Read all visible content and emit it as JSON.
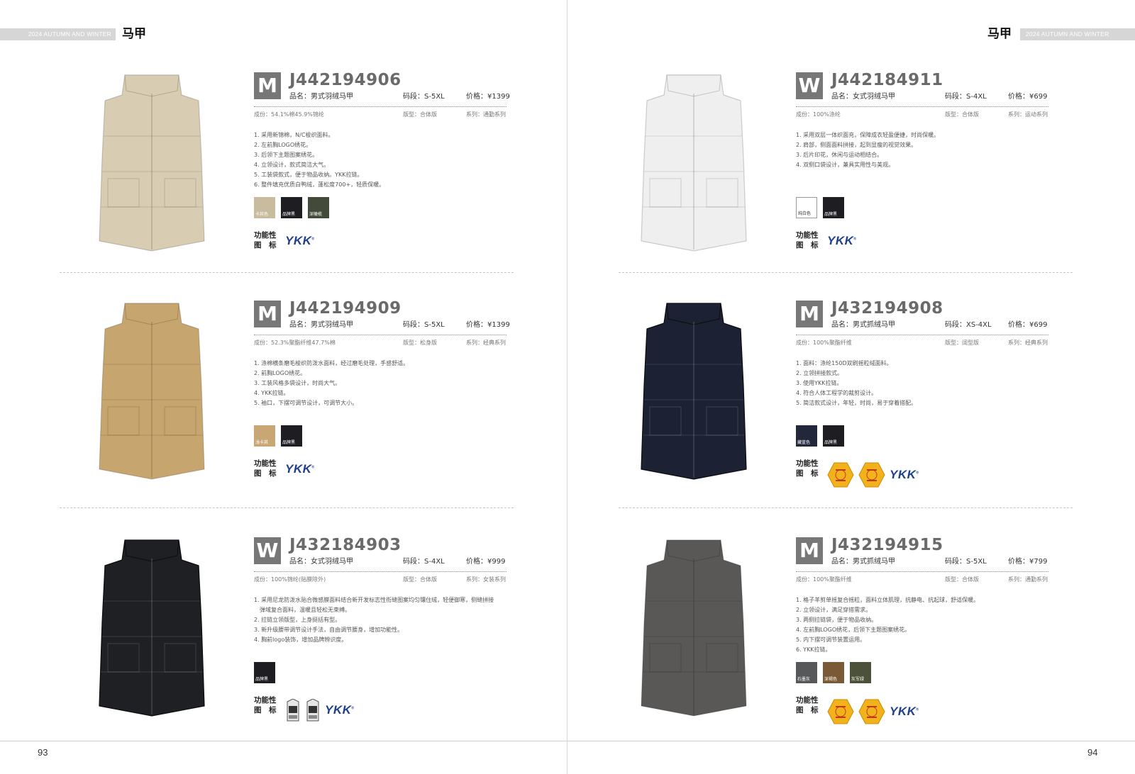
{
  "header": {
    "season": "2024 AUTUMN AND WINTER",
    "category": "马甲"
  },
  "footer": {
    "left_page": "93",
    "right_page": "94"
  },
  "labels": {
    "func_line1": "功能性",
    "func_line2": "图　标",
    "ykk": "YKK"
  },
  "colors": {
    "badge": "#777777",
    "code_text": "#6a6a6a",
    "ykk_blue": "#1e3e8e",
    "header_bar": "#d6d6d6"
  },
  "left": [
    {
      "gender": "M",
      "code": "J442194906",
      "name": "品名：男式羽绒马甲",
      "size": "码段：S-5XL",
      "price": "价格：¥1399",
      "material": "成份：54.1%棉45.9%锦纶",
      "fit": "版型：合体版",
      "series": "系列：通勤系列",
      "features": [
        "1. 采用新锦棉，N/C梭织面料。",
        "2. 左前胸LOGO绣花。",
        "3. 后领下主题图案绣花。",
        "4. 立领设计，款式简洁大气。",
        "5. 工装袋款式，便于物品收纳。YKK拉链。",
        "6. 整件填充优质白鸭绒，蓬松度700+，轻质保暖。"
      ],
      "swatches": [
        {
          "label": "卡其色",
          "color": "#c9bc9e"
        },
        {
          "label": "品牌黑",
          "color": "#1e1e22"
        },
        {
          "label": "深橄榄",
          "color": "#444a3a"
        }
      ],
      "icons": [
        "ykk-logo-icon"
      ],
      "vest_color": "#d8cdb2"
    },
    {
      "gender": "M",
      "code": "J442194909",
      "name": "品名：男式羽绒马甲",
      "size": "码段：S-5XL",
      "price": "价格：¥1399",
      "material": "成份：52.3%聚酯纤维47.7%棉",
      "fit": "版型：松身版",
      "series": "系列：经典系列",
      "features": [
        "1. 涤棉横条磨毛梭织防泼水面料，经过磨毛处理，手感舒适。",
        "2. 前胸LOGO绣花。",
        "3. 工装风格多袋设计，时尚大气。",
        "4. YKK拉链。",
        "5. 袖口，下摆可调节设计，可调节大小。"
      ],
      "swatches": [
        {
          "label": "浅卡其",
          "color": "#c9a774"
        },
        {
          "label": "品牌黑",
          "color": "#1e1e22"
        }
      ],
      "icons": [
        "ykk-logo-icon"
      ],
      "vest_color": "#c7a56f"
    },
    {
      "gender": "W",
      "code": "J432184903",
      "name": "品名：女式羽绒马甲",
      "size": "码段：S-4XL",
      "price": "价格：¥999",
      "material": "成份：100%锦纶(贴膜除外)",
      "fit": "版型：合体版",
      "series": "系列：女装系列",
      "features": [
        "1. 采用尼龙防泼水贴合微感膜面料结合新开发标志性衔缝图案均匀镶住绒，轻便御寒，侧缝拼接",
        "　弹域复合面料，温暖且轻松无束缚。",
        "2. 拉链立领版型，上身挺括有型。",
        "3. 新升级腰带调节设计手法，自由调节腰身，增加功能性。",
        "4. 胸前logo装饰，增加品牌辨识度。"
      ],
      "swatches": [
        {
          "label": "品牌黑",
          "color": "#1e1e22"
        }
      ],
      "icons": [
        "tag-icon-1",
        "tag-icon-2",
        "ykk-logo-icon"
      ],
      "vest_color": "#1f2024"
    }
  ],
  "right": [
    {
      "gender": "W",
      "code": "J442184911",
      "name": "品名：女式羽绒马甲",
      "size": "码段：S-4XL",
      "price": "价格：¥699",
      "material": "成份：100%涤纶",
      "fit": "版型：合体版",
      "series": "系列：运动系列",
      "features": [
        "1. 采用双层一体织面充，保障成衣轻盈便捷，时尚保暖。",
        "2. 肩部，侧面面料拼接，起到显瘦的视觉效果。",
        "3. 后片印花，休闲与运动相结合。",
        "4. 双侧口袋设计，兼具实用性与美观。"
      ],
      "swatches": [
        {
          "label": "纯白色",
          "color": "#ffffff"
        },
        {
          "label": "品牌黑",
          "color": "#1e1e22"
        }
      ],
      "icons": [
        "ykk-logo-icon"
      ],
      "vest_color": "#efefef"
    },
    {
      "gender": "M",
      "code": "J432194908",
      "name": "品名：男式抓绒马甲",
      "size": "码段：XS-4XL",
      "price": "价格：¥699",
      "material": "成份：100%聚酯纤维",
      "fit": "版型：阔型版",
      "series": "系列：经典系列",
      "features": [
        "1. 面料：涤纶150D双刷摇粒绒面料。",
        "2. 立领拼接款式。",
        "3. 使用YKK拉链。",
        "4. 符合人体工程学的裁剪设计。",
        "5. 简洁款式设计，年轻，时尚，易于穿着搭配。"
      ],
      "swatches": [
        {
          "label": "藏蓝色",
          "color": "#22283a"
        },
        {
          "label": "品牌黑",
          "color": "#1e1e22"
        }
      ],
      "icons": [
        "warm-hex-badge-icon",
        "warm-hex-badge-icon",
        "ykk-logo-icon"
      ],
      "vest_color": "#1c2233"
    },
    {
      "gender": "M",
      "code": "J432194915",
      "name": "品名：男式抓绒马甲",
      "size": "码段：S-5XL",
      "price": "价格：¥799",
      "material": "成份：100%聚酯纤维",
      "fit": "版型：合体版",
      "series": "系列：通勤系列",
      "features": [
        "1. 格子羊剪单摇复合摇粒，面料立体肌理，抗静电、抗起球，舒适保暖。",
        "2. 立领设计，满足穿搭需求。",
        "3. 两侧拉链袋，便于物品收纳。",
        "4. 左前胸LOGO绣花，后领下主题图案绣花。",
        "5. 内下摆可调节装置运用。",
        "6. YKK拉链。"
      ],
      "swatches": [
        {
          "label": "石墨灰",
          "color": "#56585a"
        },
        {
          "label": "深褐色",
          "color": "#7a5a36"
        },
        {
          "label": "灰军绿",
          "color": "#4c5139"
        }
      ],
      "icons": [
        "warm-hex-badge-icon",
        "warm-hex-badge-icon",
        "ykk-logo-icon"
      ],
      "vest_color": "#5a5856"
    }
  ]
}
